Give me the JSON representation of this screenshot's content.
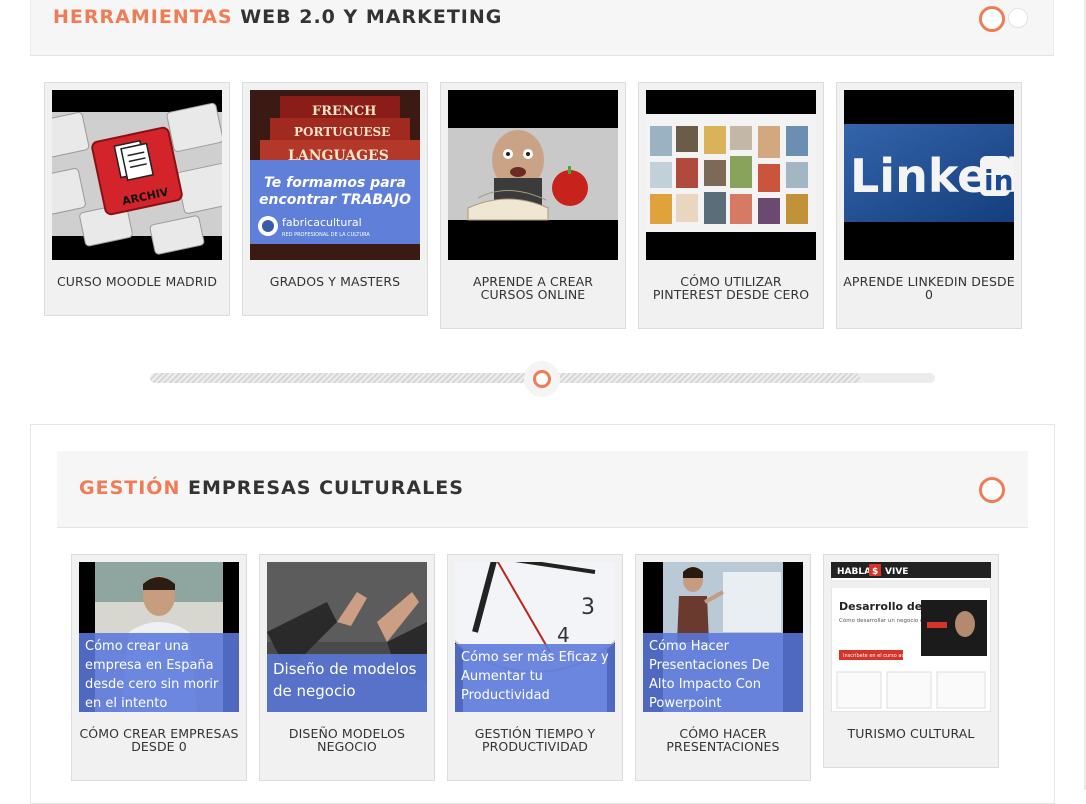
{
  "section1": {
    "title_accent": "HERRAMIENTAS",
    "title_rest": "WEB 2.0 Y MARKETING",
    "cards": [
      {
        "title": "CURSO MOODLE MADRID",
        "image": "keyboard-archiv-key"
      },
      {
        "title": "GRADOS Y MASTERS",
        "image": "books-languages",
        "overlay_line1": "Te formamos para",
        "overlay_line2": "encontrar TRABAJO",
        "logo_name": "fabricacultural",
        "logo_sub": "RED PROFESIONAL DE LA CULTURA",
        "book1": "FRENCH",
        "book2": "PORTUGUESE",
        "book3": "LANGUAGES"
      },
      {
        "title": "APRENDE A CREAR CURSOS ONLINE",
        "image": "man-books-apple"
      },
      {
        "title": "CÓMO UTILIZAR PINTEREST DESDE CERO",
        "image": "pinterest-grid"
      },
      {
        "title": "APRENDE LINKEDIN DESDE 0",
        "image": "linkedin-logo",
        "logo_text": "Linked",
        "logo_in": "in"
      }
    ]
  },
  "section2": {
    "title_accent": "GESTIÓN",
    "title_rest": "EMPRESAS CULTURALES",
    "cards": [
      {
        "title": "CÓMO CREAR EMPRESAS DESDE 0",
        "image": "man-presenting",
        "caption": "Cómo crear una empresa en España desde cero sin morir en el intento"
      },
      {
        "title": "DISEÑO MODELOS NEGOCIO",
        "image": "hands-gesture",
        "caption": "Diseño de modelos de negocio"
      },
      {
        "title": "GESTIÓN TIEMPO Y PRODUCTIVIDAD",
        "image": "clock",
        "caption": "Cómo ser más Eficaz y Aumentar tu Productividad",
        "clock_3": "3",
        "clock_4": "4"
      },
      {
        "title": "CÓMO HACER PRESENTACIONES",
        "image": "woman-presenting",
        "caption": "Cómo Hacer Presentaciones De Alto Impacto Con Powerpoint"
      },
      {
        "title": "TURISMO CULTURAL",
        "image": "habla-vive-site",
        "brand_left": "HABLA",
        "brand_mid": "$",
        "brand_right": "VIVE",
        "site_heading": "Desarrollo de Negocios",
        "site_sub": "Cómo desarrollar un negocio online sin riesgos",
        "site_cta": "Inscríbete en el curso aquí"
      }
    ]
  },
  "colors": {
    "accent": "#ef7c55",
    "caption_blue": "#5a78dc"
  },
  "slider": {
    "position": 0.5
  }
}
